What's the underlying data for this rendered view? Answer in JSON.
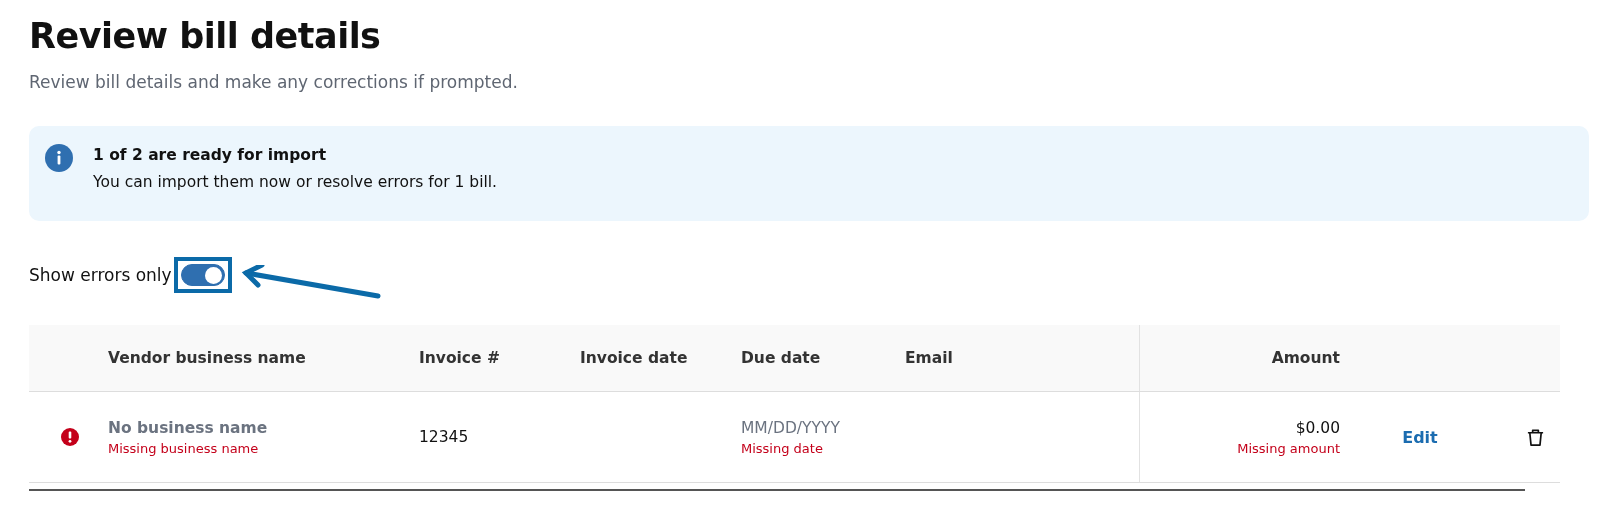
{
  "title": "Review bill details",
  "subtitle": "Review bill details and make any corrections if prompted.",
  "banner": {
    "heading": "1 of 2 are ready for import",
    "message": "You can import them now or resolve errors for 1 bill."
  },
  "toggle": {
    "label": "Show errors only",
    "on": true
  },
  "table": {
    "columns": [
      "Vendor business name",
      "Invoice #",
      "Invoice date",
      "Due date",
      "Email",
      "Amount"
    ],
    "rows": [
      {
        "has_error": true,
        "vendor": {
          "text": "No business name",
          "missing": true,
          "error": "Missing business name"
        },
        "invoice": "12345",
        "invoice_date": "",
        "due_date": {
          "text": "MM/DD/YYYY",
          "missing": true,
          "error": "Missing date"
        },
        "email": "",
        "amount": {
          "text": "$0.00",
          "missing": false,
          "error": "Missing amount"
        },
        "action": "Edit"
      }
    ]
  }
}
